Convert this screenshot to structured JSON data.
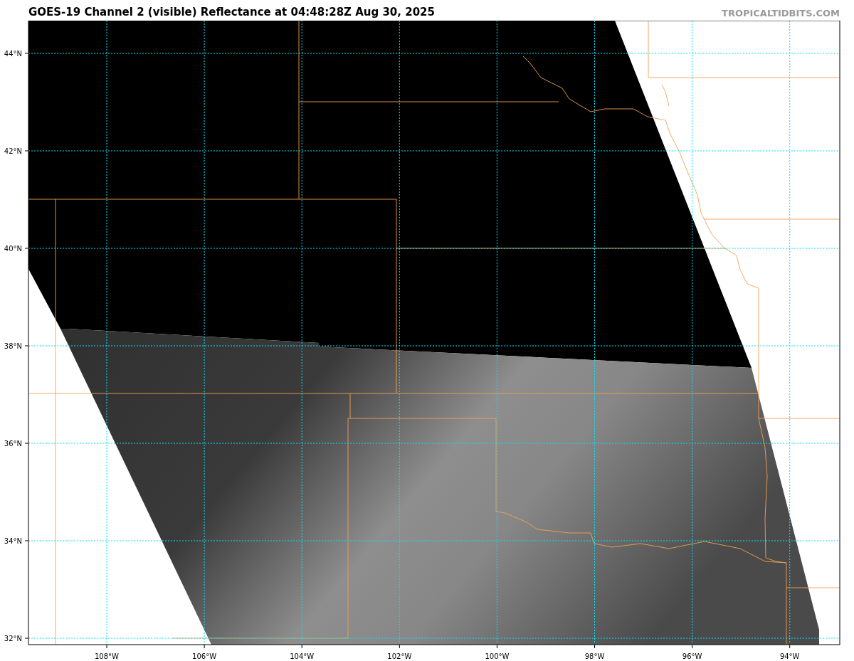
{
  "title": "GOES-19 Channel 2 (visible) Reflectance at 04:48:28Z Aug 30, 2025",
  "credit": "TROPICALTIDBITS.COM",
  "map": {
    "lat_labels": [
      "44°N",
      "42°N",
      "40°N",
      "38°N",
      "36°N",
      "34°N",
      "32°N"
    ],
    "lon_labels": [
      "108°W",
      "106°W",
      "104°W",
      "102°W",
      "100°W",
      "98°W",
      "96°W",
      "94°W"
    ]
  }
}
